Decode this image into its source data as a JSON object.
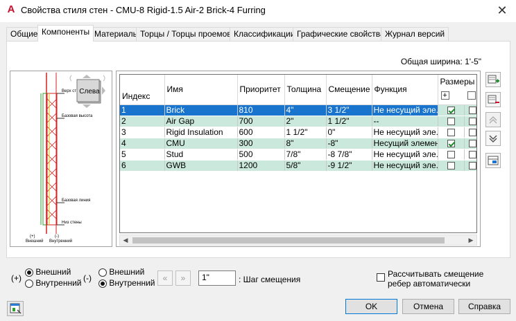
{
  "window": {
    "app_logo": "A",
    "title": "Свойства стиля стен - CMU-8 Rigid-1.5 Air-2 Brick-4 Furring",
    "close": "✕"
  },
  "tabs": [
    {
      "label": "Общие"
    },
    {
      "label": "Компоненты",
      "active": true
    },
    {
      "label": "Материалы"
    },
    {
      "label": "Торцы / Торцы проемов"
    },
    {
      "label": "Классификации"
    },
    {
      "label": "Графические свойства"
    },
    {
      "label": "Журнал версий"
    }
  ],
  "total_width": "Общая ширина: 1'-5\"",
  "preview": {
    "view_label": "Слева",
    "annotations": [
      "Верх ст",
      "Базовая высота",
      "Базовая линия",
      "Низ стены"
    ],
    "bottom_labels": [
      "(+)",
      "Внешний",
      "(-)",
      "Внутренний"
    ]
  },
  "grid": {
    "columns": [
      "Индекс",
      "Имя",
      "Приоритет",
      "Толщина",
      "Смещение",
      "Функция",
      "Размеры"
    ],
    "rows": [
      {
        "index": "1",
        "name": "Brick",
        "priority": "810",
        "thickness": "4\"",
        "offset": "3 1/2\"",
        "function": "Не несущий эле...",
        "dim": true
      },
      {
        "index": "2",
        "name": "Air Gap",
        "priority": "700",
        "thickness": "2\"",
        "offset": "1 1/2\"",
        "function": "--",
        "dim": false
      },
      {
        "index": "3",
        "name": "Rigid Insulation",
        "priority": "600",
        "thickness": "1 1/2\"",
        "offset": "0\"",
        "function": "Не несущий эле...",
        "dim": false
      },
      {
        "index": "4",
        "name": "CMU",
        "priority": "300",
        "thickness": "8\"",
        "offset": "-8\"",
        "function": "Несущий элемент",
        "dim": true
      },
      {
        "index": "5",
        "name": "Stud",
        "priority": "500",
        "thickness": "7/8\"",
        "offset": "-8 7/8\"",
        "function": "Не несущий эле...",
        "dim": false
      },
      {
        "index": "6",
        "name": "GWB",
        "priority": "1200",
        "thickness": "5/8\"",
        "offset": "-9 1/2\"",
        "function": "Не несущий эле...",
        "dim": false
      }
    ]
  },
  "side_buttons": [
    "add-component-icon",
    "remove-component-icon",
    "move-up-icon",
    "move-down-icon",
    "component-list-icon"
  ],
  "lower": {
    "plus_label": "(+)",
    "minus_label": "(-)",
    "group1": [
      "Внешний",
      "Внутренний"
    ],
    "group2": [
      "Внешний",
      "Внутренний"
    ],
    "step_value": "1\"",
    "step_label": ": Шаг смещения",
    "auto_offset_line1": "Рассчитывать смещение",
    "auto_offset_line2": "ребер автоматически"
  },
  "buttons": {
    "ok": "OK",
    "cancel": "Отмена",
    "help": "Справка"
  }
}
